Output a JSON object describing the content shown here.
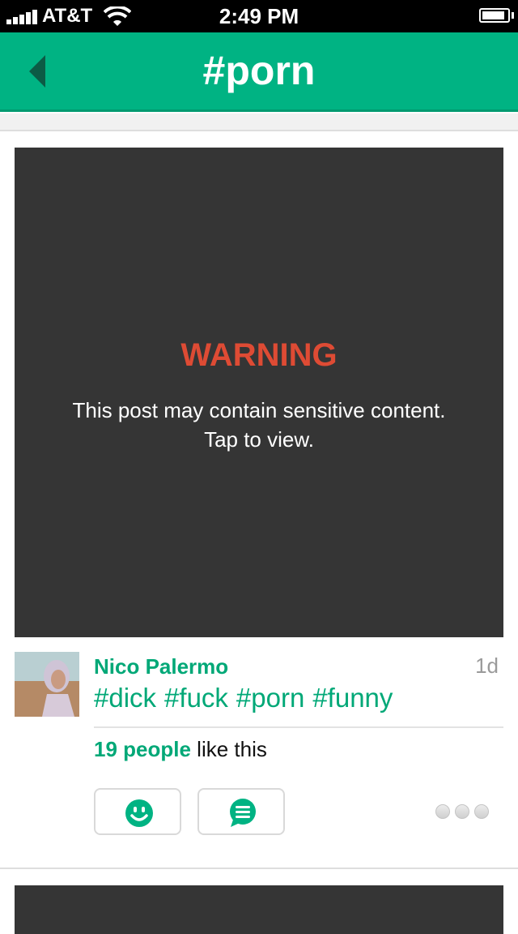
{
  "status_bar": {
    "carrier": "AT&T",
    "time": "2:49 PM",
    "signal_bars": 5,
    "wifi": "wifi-icon",
    "battery_level": 0.9
  },
  "nav": {
    "title": "#porn",
    "back_icon": "back-arrow-icon"
  },
  "post": {
    "warning_title": "WARNING",
    "warning_line1": "This post may contain sensitive content.",
    "warning_line2": "Tap to view.",
    "author": "Nico Palermo",
    "time_ago": "1d",
    "tags": [
      "#dick",
      "#fuck",
      "#porn",
      "#funny"
    ],
    "likes_count": "19 people",
    "likes_suffix": " like this",
    "like_icon": "smiley-icon",
    "comment_icon": "comment-bubble-icon",
    "more_icon": "more-dots-icon"
  },
  "colors": {
    "accent": "#00b383",
    "warning": "#de4b34",
    "media_bg": "#353535"
  }
}
